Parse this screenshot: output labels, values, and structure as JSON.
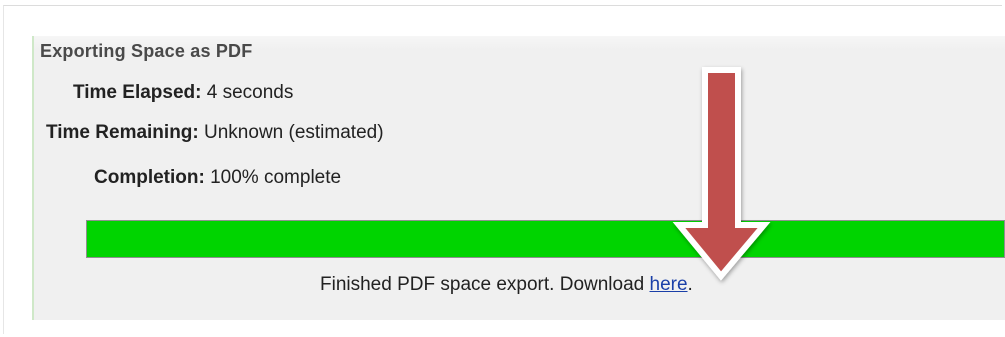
{
  "panel": {
    "title": "Exporting Space as PDF"
  },
  "details": {
    "elapsed_label": "Time Elapsed:",
    "elapsed_value": "4 seconds",
    "remaining_label": "Time Remaining:",
    "remaining_value": "Unknown (estimated)",
    "completion_label": "Completion:",
    "completion_value": "100% complete"
  },
  "progress": {
    "fraction": 1.0,
    "fill_color": "#00d400"
  },
  "status": {
    "message_prefix": "Finished PDF space export. Download",
    "link_text": "here",
    "message_suffix": "."
  },
  "annotation": {
    "icon": "down-arrow-icon",
    "color": "#c0504d"
  }
}
